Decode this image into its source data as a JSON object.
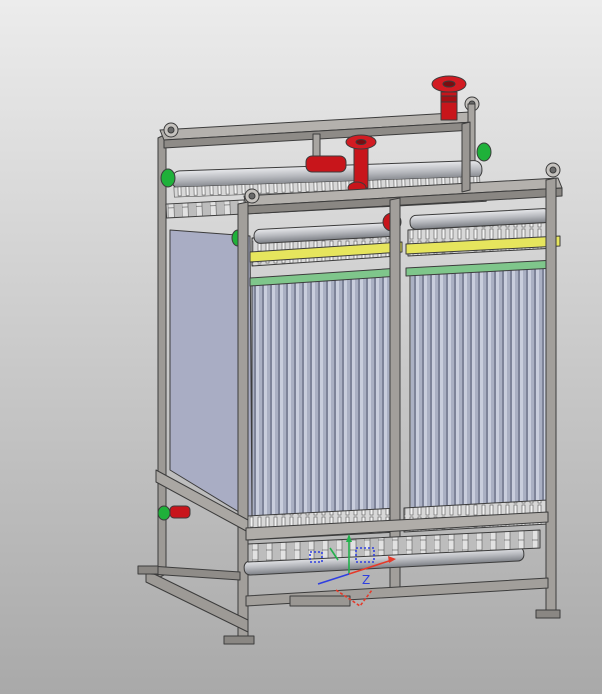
{
  "viewport": {
    "background_top": "#ececec",
    "background_bottom": "#a9a9a9"
  },
  "model": {
    "frame_color": "#a7a4a0",
    "frame_outline": "#3c3c3c",
    "panel_color": "#a9adc4",
    "membrane_color": "#aab0c3",
    "header_pipe_color": "#c2c4c8",
    "flange_color": "#c8151b",
    "fitting_color": "#1fb13a",
    "yellow_bar_color": "#e6e55d",
    "green_bar_color": "#7fc68b"
  },
  "triad": {
    "x_color": "#e53a2a",
    "y_color": "#22b14c",
    "z_color": "#2f3fe0",
    "z_label": "Z"
  }
}
